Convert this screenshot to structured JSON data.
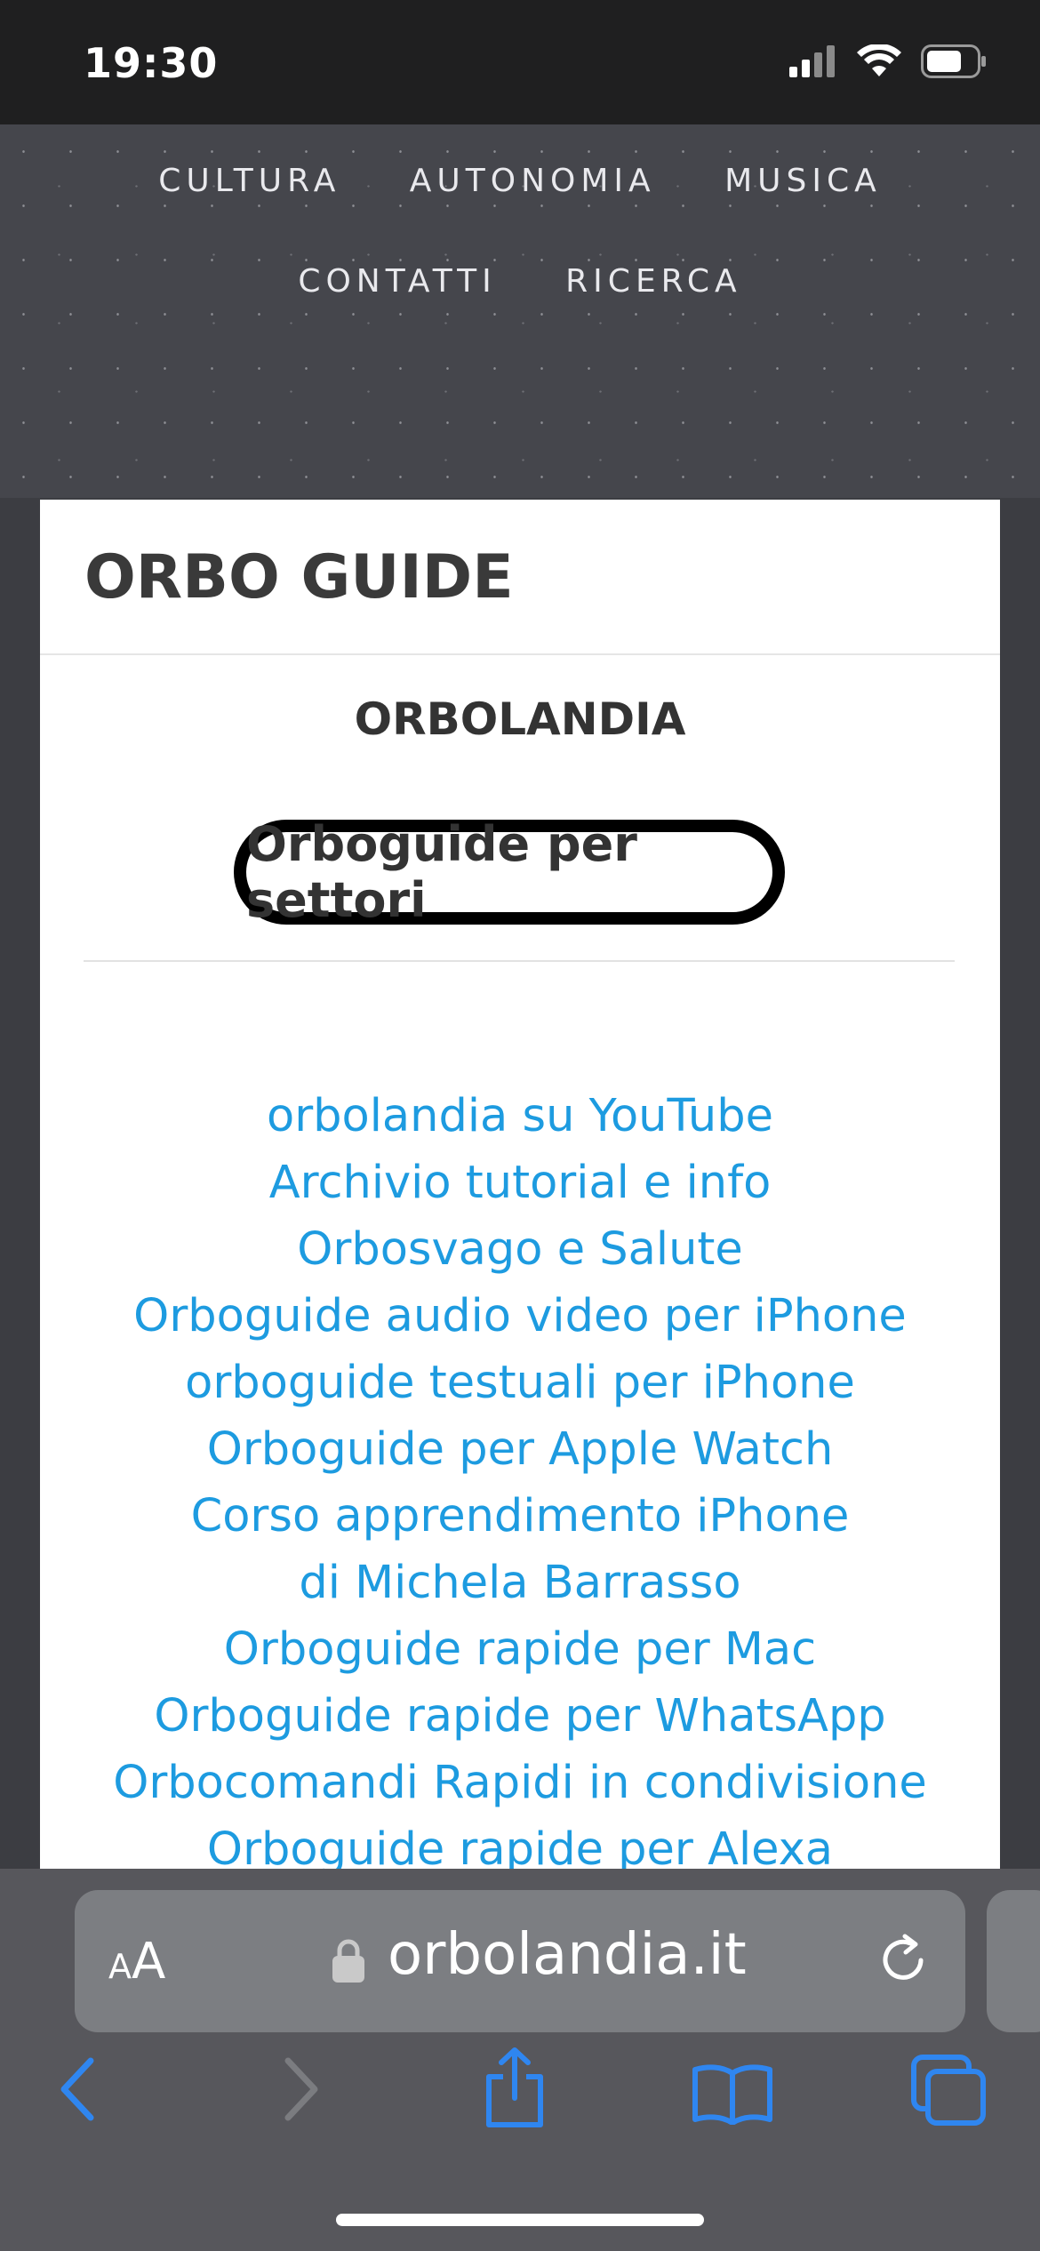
{
  "status_bar": {
    "time": "19:30"
  },
  "nav": {
    "row1": [
      "CULTURA",
      "AUTONOMIA",
      "MUSICA"
    ],
    "row2": [
      "CONTATTI",
      "RICERCA"
    ]
  },
  "card": {
    "title": "ORBO GUIDE",
    "subtitle": "ORBOLANDIA",
    "highlighted_link": "Orboguide per settori",
    "links": [
      "orbolandia su YouTube",
      "Archivio tutorial e info",
      "Orbosvago e Salute",
      "Orboguide audio video per iPhone",
      "orboguide testuali per iPhone",
      "Orboguide per Apple Watch",
      "Corso apprendimento iPhone",
      "di Michela Barrasso",
      "Orboguide rapide per Mac",
      "Orboguide rapide per WhatsApp",
      "Orbocomandi Rapidi in condivisione",
      "Orboguide rapide per Alexa"
    ]
  },
  "browser": {
    "text_size_label": "AA",
    "domain": "orbolandia.it"
  },
  "colors": {
    "link": "#1d9be0",
    "accent": "#2f86f0"
  }
}
